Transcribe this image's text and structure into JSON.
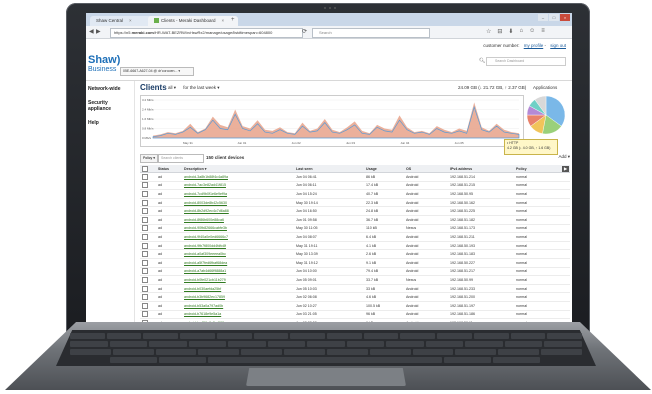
{
  "browser": {
    "tabs": [
      {
        "label": "Shaw Central",
        "close": "×"
      },
      {
        "label": "Clients - Meraki Dashboard",
        "close": "×"
      }
    ],
    "new_tab": "+",
    "window_buttons": [
      "–",
      "□",
      "×"
    ],
    "nav": {
      "back": "◀",
      "forward": "▶",
      "reload": "⟳"
    },
    "url_prefix": "https://n5.",
    "url_domain": "meraki.com",
    "url_rest": "/HR-WAT-BEZRW/n/rlswRx2/manage/usage/list#timespan=604800",
    "search_placeholder": "Search",
    "toolbar_icons": [
      "☆",
      "⊟",
      "⬇",
      "⌂",
      "☺",
      "≡"
    ]
  },
  "header": {
    "customer_number": "customer number:",
    "my_profile": "my profile",
    "sign_out": "sign out",
    "logo_top": "Shaw)",
    "logo_bottom": "Business",
    "network_select": "05E-6667-A627-04 @ dr'corooen... ▾",
    "search_dashboard_placeholder": "Search Dashboard"
  },
  "sidebar": {
    "items": [
      "Network-wide",
      "Security appliance",
      "Help"
    ]
  },
  "clients": {
    "title": "Clients",
    "filter_all": "all ▾",
    "filter_range": "for the last week ▾",
    "usage_summary": "24.09 GB (↓ 21.72 GB, ↑ 2.37 GB)",
    "applications": "Applications",
    "tooltip_line1": "• HTTP",
    "tooltip_line2": "4.2 GB (↓ 4.0 GB, ↑ 1.6 GB)",
    "policy_button": "Policy ▾",
    "search_clients_placeholder": "Search clients",
    "client_count": "150 client devices",
    "add_col": "Add ▾",
    "sort_button": "▶"
  },
  "chart_data": {
    "type": "area",
    "title": "",
    "xlabel": "",
    "ylabel": "",
    "y_ticks": [
      "3.2 Mb/s",
      "2.4 Mb/s",
      "1.6 Mb/s",
      "0.8 Mb/s",
      "0 Mb/s"
    ],
    "x_ticks": [
      "May 31",
      "Jun 01",
      "Jun 02",
      "Jun 03",
      "Jun 04",
      "Jun 05",
      "Jun 06"
    ],
    "ylim": [
      0,
      3.2
    ],
    "series": [
      {
        "values": [
          0.2,
          0.3,
          0.5,
          0.4,
          0.6,
          1.2,
          0.5,
          0.8,
          1.8,
          1.1,
          0.9,
          2.4,
          1.0,
          0.8,
          1.5,
          0.7,
          0.6,
          0.9,
          0.5,
          0.4,
          1.3,
          0.6,
          0.8,
          1.6,
          0.7,
          0.5,
          0.9,
          1.4,
          0.6,
          0.4,
          1.1,
          0.8,
          0.7,
          1.9,
          0.9,
          0.5,
          0.6,
          0.4,
          1.0,
          0.7,
          0.5,
          0.8,
          0.6,
          3.0,
          0.9,
          0.6,
          1.2,
          0.7,
          0.5,
          0.4
        ]
      },
      {
        "values": [
          0.1,
          0.2,
          0.4,
          0.3,
          0.5,
          0.9,
          0.4,
          0.7,
          1.5,
          0.8,
          0.7,
          2.0,
          0.8,
          0.6,
          1.2,
          0.5,
          0.4,
          0.7,
          0.4,
          0.3,
          1.0,
          0.5,
          0.6,
          1.3,
          0.5,
          0.4,
          0.7,
          1.1,
          0.4,
          0.3,
          0.9,
          0.6,
          0.5,
          1.5,
          0.7,
          0.4,
          0.5,
          0.3,
          0.8,
          0.5,
          0.4,
          0.6,
          0.4,
          2.6,
          0.7,
          0.5,
          1.0,
          0.5,
          0.4,
          0.3
        ]
      }
    ],
    "pie_slices": [
      {
        "value": 0.35,
        "color": "#7ab8e8"
      },
      {
        "value": 0.18,
        "color": "#9ad07a"
      },
      {
        "value": 0.12,
        "color": "#f1c45a"
      },
      {
        "value": 0.1,
        "color": "#e8826b"
      },
      {
        "value": 0.08,
        "color": "#b48ad6"
      },
      {
        "value": 0.07,
        "color": "#6fd0c6"
      },
      {
        "value": 0.1,
        "color": "#d8d8d8"
      }
    ],
    "colors": {
      "download": "#e8a28a",
      "upload": "#5b9bd5"
    }
  },
  "table": {
    "headers": [
      "",
      "Status",
      "Description ▾",
      "Last seen",
      "Usage",
      "OS",
      "IPv4 address",
      "Policy",
      ""
    ],
    "rows": [
      [
        "ad",
        "android-3a8b1b88f4c4a89a",
        "Jun 04 06:41",
        "86 kB",
        "Android",
        "192.168.51.214",
        "normal"
      ],
      [
        "ad",
        "android-7ac3e82ad41f815",
        "Jun 04 06:11",
        "17.4 kB",
        "Android",
        "192.168.51.215",
        "normal"
      ],
      [
        "ad",
        "android-7cd9b0f1e6e9ef9a",
        "Jun 04 15:24",
        "40.7 kB",
        "Android",
        "192.168.50.95",
        "normal"
      ],
      [
        "ad",
        "android-8003de8b42c5630",
        "May 30 19:14",
        "22.3 kB",
        "Android",
        "192.168.50.162",
        "normal"
      ],
      [
        "ad",
        "android-8b2d92ec4c7d6a88",
        "Jun 04 16:50",
        "24.8 kB",
        "Android",
        "192.168.51.225",
        "normal"
      ],
      [
        "ad",
        "android-8f86b600e88ca6",
        "Jun 01 09:58",
        "36.7 kB",
        "Android",
        "192.168.51.182",
        "normal"
      ],
      [
        "ad",
        "android-90fb82666cabfe3b",
        "May 30 11:05",
        "110 kB",
        "Nexus",
        "192.168.51.173",
        "normal"
      ],
      [
        "ad",
        "android-9f40a0e0ed6666c7",
        "Jun 04 08:07",
        "6.4 kB",
        "Android",
        "192.168.51.211",
        "normal"
      ],
      [
        "ad",
        "android-9fb7f800dd4fdfc8f",
        "May 31 19:11",
        "4.1 kB",
        "Android",
        "192.168.50.193",
        "normal"
      ],
      [
        "ad",
        "android-a0af309eeeea0bc",
        "May 30 13:39",
        "2.6 kB",
        "Android",
        "192.168.51.183",
        "normal"
      ],
      [
        "ad",
        "android-a5f7fed6fbaf68dea",
        "May 31 19:12",
        "9.1 kB",
        "Android",
        "192.168.50.227",
        "normal"
      ],
      [
        "ad",
        "android-a7ab4d66f9888a1",
        "Jun 04 10:00",
        "79.4 kB",
        "Android",
        "192.168.51.217",
        "normal"
      ],
      [
        "ad",
        "android-b0fe021cb11b279",
        "Jun 05 09:01",
        "33.7 kB",
        "Nexus",
        "192.168.50.99",
        "normal"
      ],
      [
        "ad",
        "android-b030aefda25bf",
        "Jun 05 10:03",
        "33 kB",
        "Android",
        "192.168.51.233",
        "normal"
      ],
      [
        "ad",
        "android-b3b9682ec17859",
        "Jun 02 06:08",
        "4.6 kB",
        "Android",
        "192.168.51.200",
        "normal"
      ],
      [
        "ad",
        "android-b53a0a797ad0b",
        "Jun 02 10:27",
        "100.5 kB",
        "Android",
        "192.168.51.197",
        "normal"
      ],
      [
        "ad",
        "android-b7618e9e5a1a",
        "Jun 03 21:05",
        "96 kB",
        "Android",
        "192.168.51.186",
        "normal"
      ],
      [
        "ad",
        "android-ba459c8e5a4f88",
        "Jun 02 22:53",
        "6 kB",
        "Android",
        "192.168.50.11",
        "normal"
      ]
    ]
  }
}
